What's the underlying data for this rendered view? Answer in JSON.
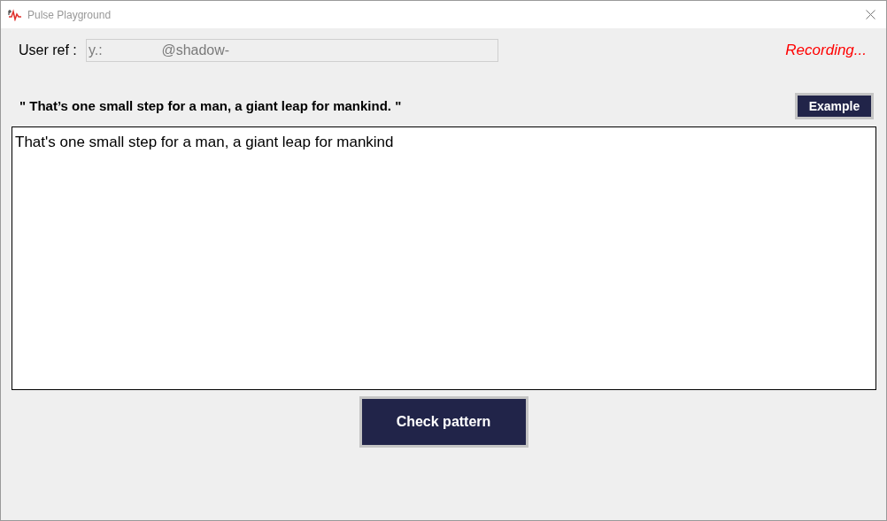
{
  "window": {
    "title": "Pulse Playground"
  },
  "user_ref": {
    "label": "User ref :",
    "value": "y.:               @shadow-",
    "disabled": true
  },
  "status": {
    "text": "Recording...",
    "recording": true
  },
  "prompt": {
    "text": "\" That’s one small step for a man, a giant leap for mankind. \""
  },
  "example_button": {
    "label": "Example"
  },
  "answer": {
    "value": "That's one small step for a man, a giant leap for mankind"
  },
  "check_button": {
    "label": "Check pattern"
  }
}
